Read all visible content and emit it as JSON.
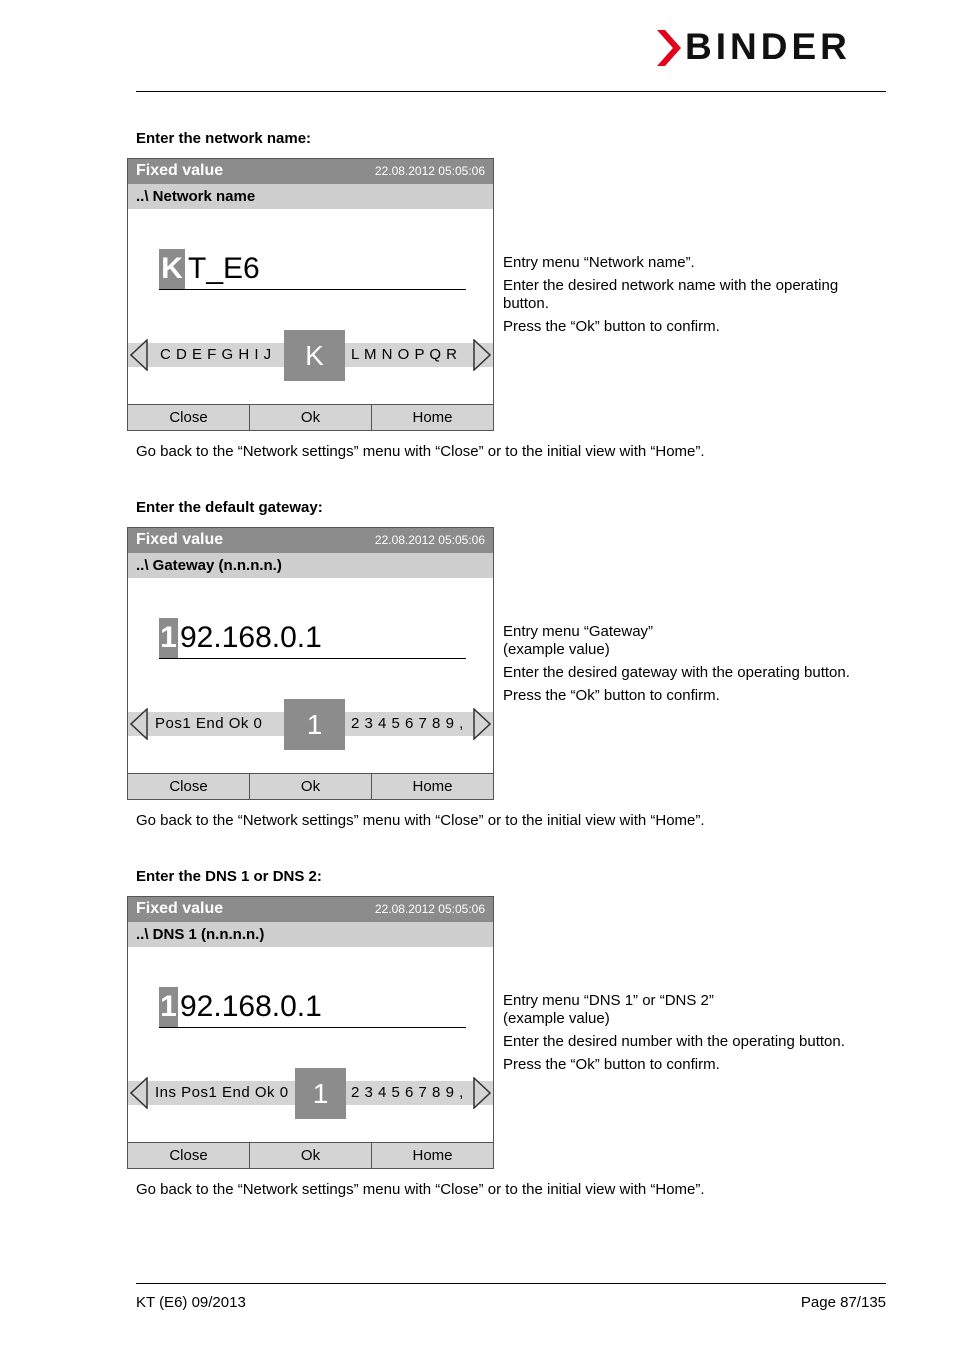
{
  "brand": {
    "name": "BINDER",
    "accent_color": "#e2001a"
  },
  "sections": [
    {
      "heading": "Enter the network name:",
      "screen": {
        "title": "Fixed value",
        "datetime": "22.08.2012  05:05:06",
        "subtitle": "..\\ Network name",
        "cursor_char": "K",
        "value_rest": "T_E6",
        "strip_left": "C D E F G H I J",
        "strip_selected": "K",
        "strip_right": "L M N O P Q R",
        "buttons": [
          "Close",
          "Ok",
          "Home"
        ]
      },
      "description": [
        "Entry menu “Network name”.",
        "Enter the desired network name with the operating button.",
        "Press the “Ok” button to confirm."
      ],
      "note": "Go back to the “Network settings” menu with “Close” or to the initial view with “Home”."
    },
    {
      "heading": "Enter the default gateway:",
      "screen": {
        "title": "Fixed value",
        "datetime": "22.08.2012  05:05:06",
        "subtitle": "..\\ Gateway (n.n.n.n.)",
        "cursor_char": "1",
        "value_rest": "92.168.0.1",
        "strip_left": "Pos1  End  Ok  0",
        "strip_selected": "1",
        "strip_right": "2 3 4 5 6 7 8 9 ,",
        "buttons": [
          "Close",
          "Ok",
          "Home"
        ]
      },
      "description": [
        "Entry menu “Gateway”",
        "(example value)",
        "Enter the desired gateway with the operating button.",
        "Press the “Ok” button to confirm."
      ],
      "note": "Go back to the “Network settings” menu with “Close” or to the initial view with “Home”."
    },
    {
      "heading": "Enter the DNS 1 or DNS 2:",
      "screen": {
        "title": "Fixed value",
        "datetime": "22.08.2012  05:05:06",
        "subtitle": "..\\ DNS 1 (n.n.n.n.)",
        "cursor_char": "1",
        "value_rest": "92.168.0.1",
        "strip_left": "Ins Pos1 End Ok 0",
        "strip_selected": "1",
        "strip_right": "2 3 4 5 6 7 8 9 ,",
        "buttons": [
          "Close",
          "Ok",
          "Home"
        ]
      },
      "description": [
        "Entry menu “DNS 1” or “DNS 2”",
        "(example value)",
        "Enter the desired number with the operating button.",
        "Press the “Ok” button to confirm."
      ],
      "note": "Go back to the “Network settings” menu with “Close” or to the initial view with “Home”."
    }
  ],
  "footer": {
    "left": "KT (E6) 09/2013",
    "right": "Page 87/135"
  }
}
